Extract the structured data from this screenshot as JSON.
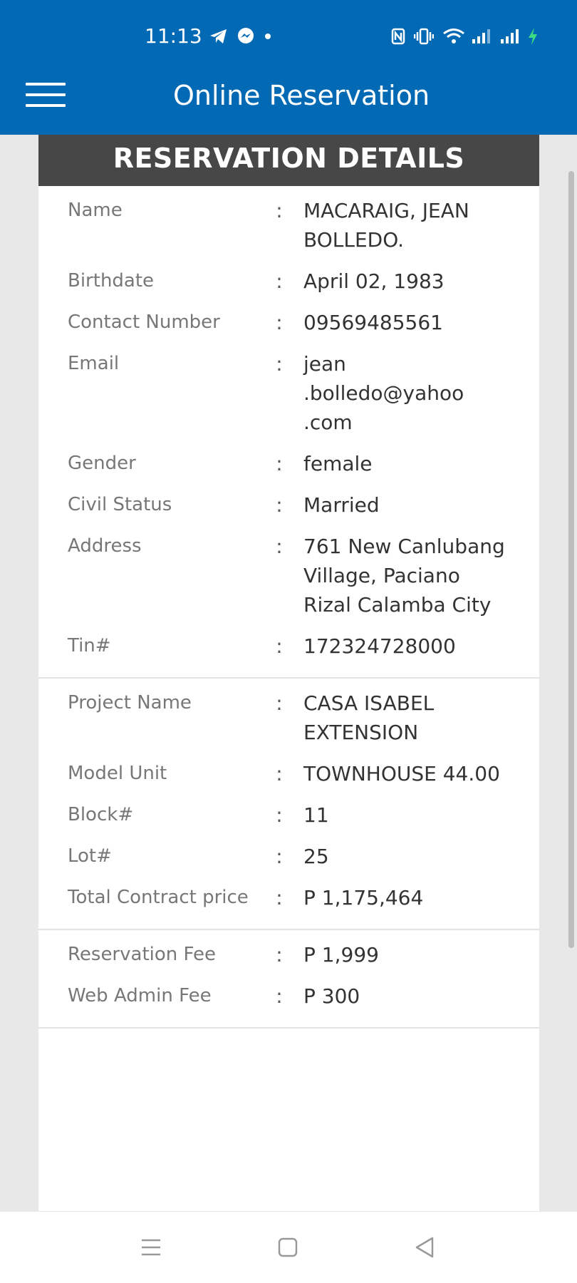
{
  "status_bar": {
    "time": "11:13",
    "icons": [
      "telegram-icon",
      "messenger-icon",
      "dot-icon",
      "nfc-icon",
      "vibrate-icon",
      "wifi-icon",
      "signal-icon",
      "signal-icon",
      "charging-icon"
    ]
  },
  "appbar": {
    "title": "Online Reservation",
    "menu_icon": "hamburger-menu-icon"
  },
  "card": {
    "header": "RESERVATION DETAILS",
    "separator": ":",
    "personal": [
      {
        "label": "Name",
        "value": "MACARAIG, JEAN BOLLEDO."
      },
      {
        "label": "Birthdate",
        "value": "April 02, 1983"
      },
      {
        "label": "Contact Number",
        "value": "09569485561"
      },
      {
        "label": "Email",
        "value": "jean .bolledo@yahoo .com"
      },
      {
        "label": "Gender",
        "value": "female"
      },
      {
        "label": "Civil Status",
        "value": "Married"
      },
      {
        "label": "Address",
        "value": "761 New Canlubang Village, Paciano Rizal Calamba City"
      },
      {
        "label": "Tin#",
        "value": "172324728000"
      }
    ],
    "property": [
      {
        "label": "Project Name",
        "value": "CASA ISABEL EXTENSION"
      },
      {
        "label": "Model Unit",
        "value": "TOWNHOUSE 44.00"
      },
      {
        "label": "Block#",
        "value": "11"
      },
      {
        "label": "Lot#",
        "value": "25"
      },
      {
        "label": "Total Contract price",
        "value": "P 1,175,464"
      }
    ],
    "fees": [
      {
        "label": "Reservation Fee",
        "value": "P 1,999"
      },
      {
        "label": "Web Admin Fee",
        "value": "P 300"
      }
    ]
  },
  "nav": {
    "buttons": [
      "recent-apps-icon",
      "home-icon",
      "back-icon"
    ]
  },
  "colors": {
    "appbar": "#0269b4",
    "card_header": "#474747",
    "label_text": "#777777",
    "value_text": "#333333",
    "page_background": "#e8e8e8"
  }
}
